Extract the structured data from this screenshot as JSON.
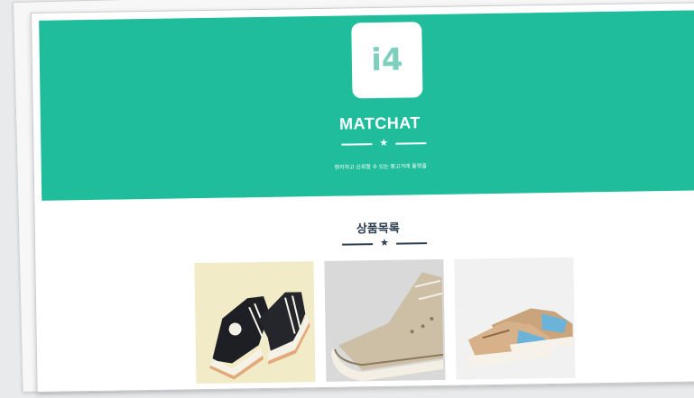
{
  "logo": {
    "text": "i4"
  },
  "hero": {
    "brand": "MATCHAT",
    "tagline": "편리하고 신뢰할 수 있는 중고거래 플랫폼"
  },
  "products_section": {
    "title": "상품목록",
    "items": [
      {
        "image": "black-converse-high-top-sneaker"
      },
      {
        "image": "beige-chuck-70-high-top-sneaker"
      },
      {
        "image": "tan-blue-retro-runner-sneakers"
      }
    ]
  },
  "colors": {
    "accent": "#1fbd9c",
    "heading": "#2d3e50"
  }
}
